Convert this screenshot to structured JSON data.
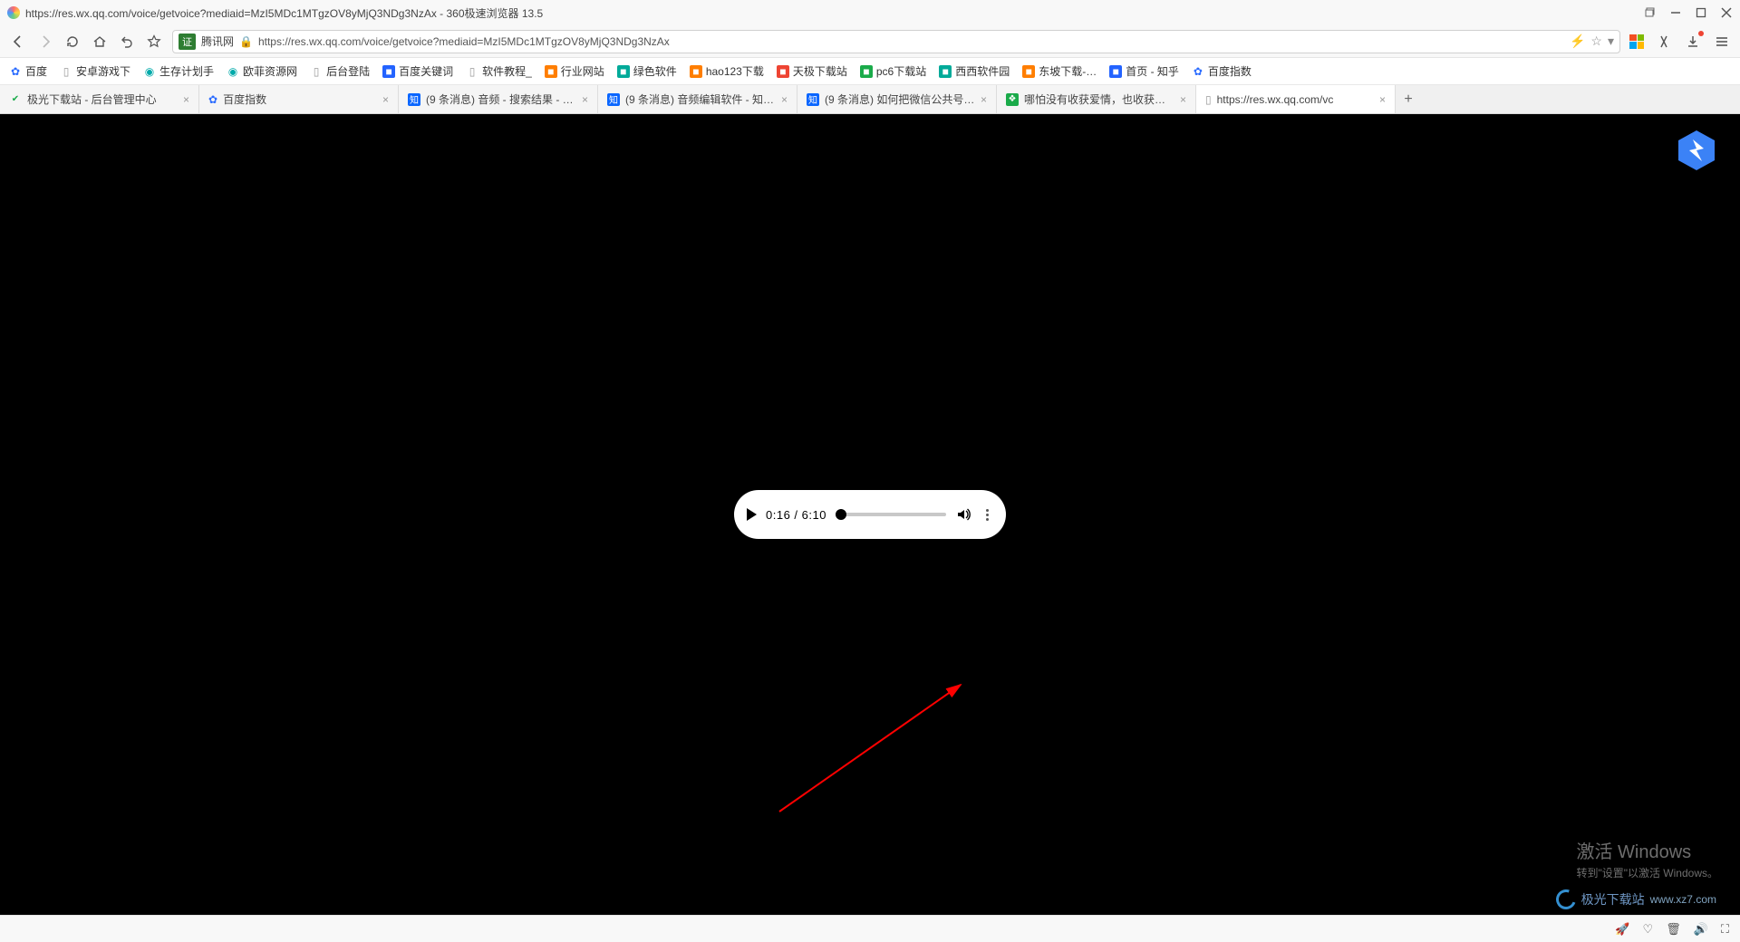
{
  "window": {
    "title": "https://res.wx.qq.com/voice/getvoice?mediaid=MzI5MDc1MTgzOV8yMjQ3NDg3NzAx - 360极速浏览器 13.5"
  },
  "address": {
    "cert_label": "证",
    "site_label": "腾讯网",
    "url": "https://res.wx.qq.com/voice/getvoice?mediaid=MzI5MDc1MTgzOV8yMjQ3NDg3NzAx"
  },
  "bookmarks": [
    {
      "label": "百度",
      "icon": "paw"
    },
    {
      "label": "安卓游戏下",
      "icon": "doc"
    },
    {
      "label": "生存计划手",
      "icon": "orbit"
    },
    {
      "label": "欧菲资源网",
      "icon": "orbit"
    },
    {
      "label": "后台登陆",
      "icon": "doc"
    },
    {
      "label": "百度关键词",
      "icon": "sq-blue"
    },
    {
      "label": "软件教程_",
      "icon": "doc"
    },
    {
      "label": "行业网站",
      "icon": "sq-orange"
    },
    {
      "label": "绿色软件",
      "icon": "sq-teal"
    },
    {
      "label": "hao123下载",
      "icon": "sq-orange"
    },
    {
      "label": "天极下载站",
      "icon": "sq-red"
    },
    {
      "label": "pc6下载站",
      "icon": "sq-green"
    },
    {
      "label": "西西软件园",
      "icon": "sq-teal"
    },
    {
      "label": "东坡下载-…",
      "icon": "sq-orange"
    },
    {
      "label": "首页 - 知乎",
      "icon": "sq-blue"
    },
    {
      "label": "百度指数",
      "icon": "paw"
    }
  ],
  "tabs": [
    {
      "label": "极光下载站 - 后台管理中心",
      "icon": "green-dot"
    },
    {
      "label": "百度指数",
      "icon": "paw"
    },
    {
      "label": "(9 条消息) 音频 - 搜索结果 - …",
      "icon": "zhi"
    },
    {
      "label": "(9 条消息) 音频编辑软件 - 知…",
      "icon": "zhi"
    },
    {
      "label": "(9 条消息) 如何把微信公共号…",
      "icon": "zhi"
    },
    {
      "label": "哪怕没有收获爱情，也收获…",
      "icon": "wechat"
    },
    {
      "label": "https://res.wx.qq.com/vc",
      "icon": "doc",
      "active": true
    }
  ],
  "player": {
    "current": "0:16",
    "sep": " / ",
    "total": "6:10"
  },
  "watermark": {
    "line1": "激活 Windows",
    "line2": "转到\"设置\"以激活 Windows。",
    "site_text": "极光下载站",
    "site_url": "www.xz7.com"
  }
}
